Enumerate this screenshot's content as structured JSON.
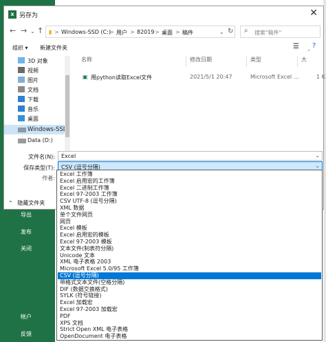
{
  "background": {
    "excel_menu": [
      "导出",
      "发布",
      "关闭",
      "帐户",
      "反馈"
    ]
  },
  "dialog": {
    "title": "另存为",
    "title_icon": "x",
    "close": "✕",
    "address": {
      "root": "Windows-SSD (C:)",
      "parts": [
        "用户",
        "82019",
        "桌面",
        "稿件"
      ],
      "sep": ">"
    },
    "search_placeholder": "搜索\"稿件\"",
    "toolbar": {
      "organize": "组织 ▾",
      "new_folder": "新建文件夹"
    },
    "left_nav": [
      {
        "label": "3D 对象",
        "icon": "3d-objects-icon"
      },
      {
        "label": "视频",
        "icon": "video-icon"
      },
      {
        "label": "图片",
        "icon": "pictures-icon"
      },
      {
        "label": "文档",
        "icon": "documents-icon"
      },
      {
        "label": "下载",
        "icon": "downloads-icon"
      },
      {
        "label": "音乐",
        "icon": "music-icon"
      },
      {
        "label": "桌面",
        "icon": "desktop-icon"
      },
      {
        "label": "Windows-SSD",
        "icon": "drive-icon",
        "selected": true
      },
      {
        "label": "Data (D:)",
        "icon": "drive-icon"
      }
    ],
    "columns": [
      "名称",
      "修改日期",
      "类型",
      "大"
    ],
    "files": [
      {
        "name": "用python读取Excel文件",
        "date": "2021/5/1 20:47",
        "type": "Microsoft Excel ...",
        "size": "1 K"
      }
    ],
    "form": {
      "filename_label": "文件名(N):",
      "filename_value": "Excel",
      "filetype_label": "保存类型(T):",
      "filetype_value": "CSV (逗号分隔)",
      "author_label": "作者:"
    },
    "hide_folders": "隐藏文件夹"
  },
  "file_types": [
    "Excel 工作簿",
    "Excel 启用宏的工作簿",
    "Excel 二进制工作簿",
    "Excel 97-2003 工作簿",
    "CSV UTF-8 (逗号分隔)",
    "XML 数据",
    "单个文件网页",
    "网页",
    "Excel 模板",
    "Excel 启用宏的模板",
    "Excel 97-2003 模板",
    "文本文件(制表符分隔)",
    "Unicode 文本",
    "XML 电子表格 2003",
    "Microsoft Excel 5.0/95 工作簿",
    "CSV (逗号分隔)",
    "带格式文本文件(空格分隔)",
    "DIF (数据交换格式)",
    "SYLK (符号链接)",
    "Excel 加载宏",
    "Excel 97-2003 加载宏",
    "PDF",
    "XPS 文档",
    "Strict Open XML 电子表格",
    "OpenDocument 电子表格"
  ],
  "selected_type_index": 15,
  "colors": {
    "excel_green": "#1f7245",
    "selection_blue": "#0078d7"
  }
}
